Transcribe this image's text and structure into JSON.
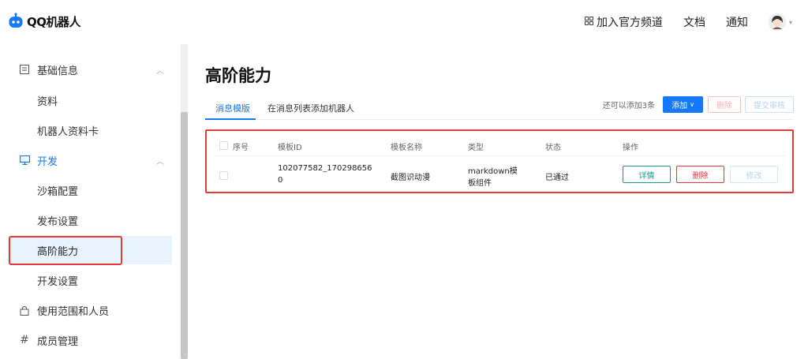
{
  "app": {
    "logo_text": "QQ机器人"
  },
  "topnav": {
    "join_channel": "加入官方频道",
    "docs": "文档",
    "notify": "通知"
  },
  "sidebar": {
    "items": [
      {
        "label": "基础信息",
        "icon": "document-icon"
      },
      {
        "label": "资料"
      },
      {
        "label": "机器人资料卡"
      },
      {
        "label": "开发",
        "icon": "monitor-icon"
      },
      {
        "label": "沙箱配置"
      },
      {
        "label": "发布设置"
      },
      {
        "label": "高阶能力"
      },
      {
        "label": "开发设置"
      },
      {
        "label": "使用范围和人员",
        "icon": "lock-icon"
      },
      {
        "label": "成员管理",
        "icon": "hash-icon"
      }
    ]
  },
  "main": {
    "title": "高阶能力",
    "tabs": [
      {
        "label": "消息模版"
      },
      {
        "label": "在消息列表添加机器人"
      }
    ],
    "toolbar": {
      "remaining": "还可以添加3条",
      "add": "添加",
      "delete": "删除",
      "submit": "提交审核"
    },
    "table": {
      "headers": [
        "序号",
        "模板ID",
        "模板名称",
        "类型",
        "状态",
        "操作"
      ],
      "rows": [
        {
          "id_line1": "102077582_170298656",
          "id_line2": "0",
          "name": "截图识动漫",
          "type_line1": "markdown模",
          "type_line2": "板组件",
          "status": "已通过",
          "actions": [
            "详情",
            "删除",
            "修改"
          ]
        }
      ]
    }
  },
  "colors": {
    "accent": "#1677ff",
    "highlight": "#e23b3b",
    "detail": "#1a9a8a"
  }
}
